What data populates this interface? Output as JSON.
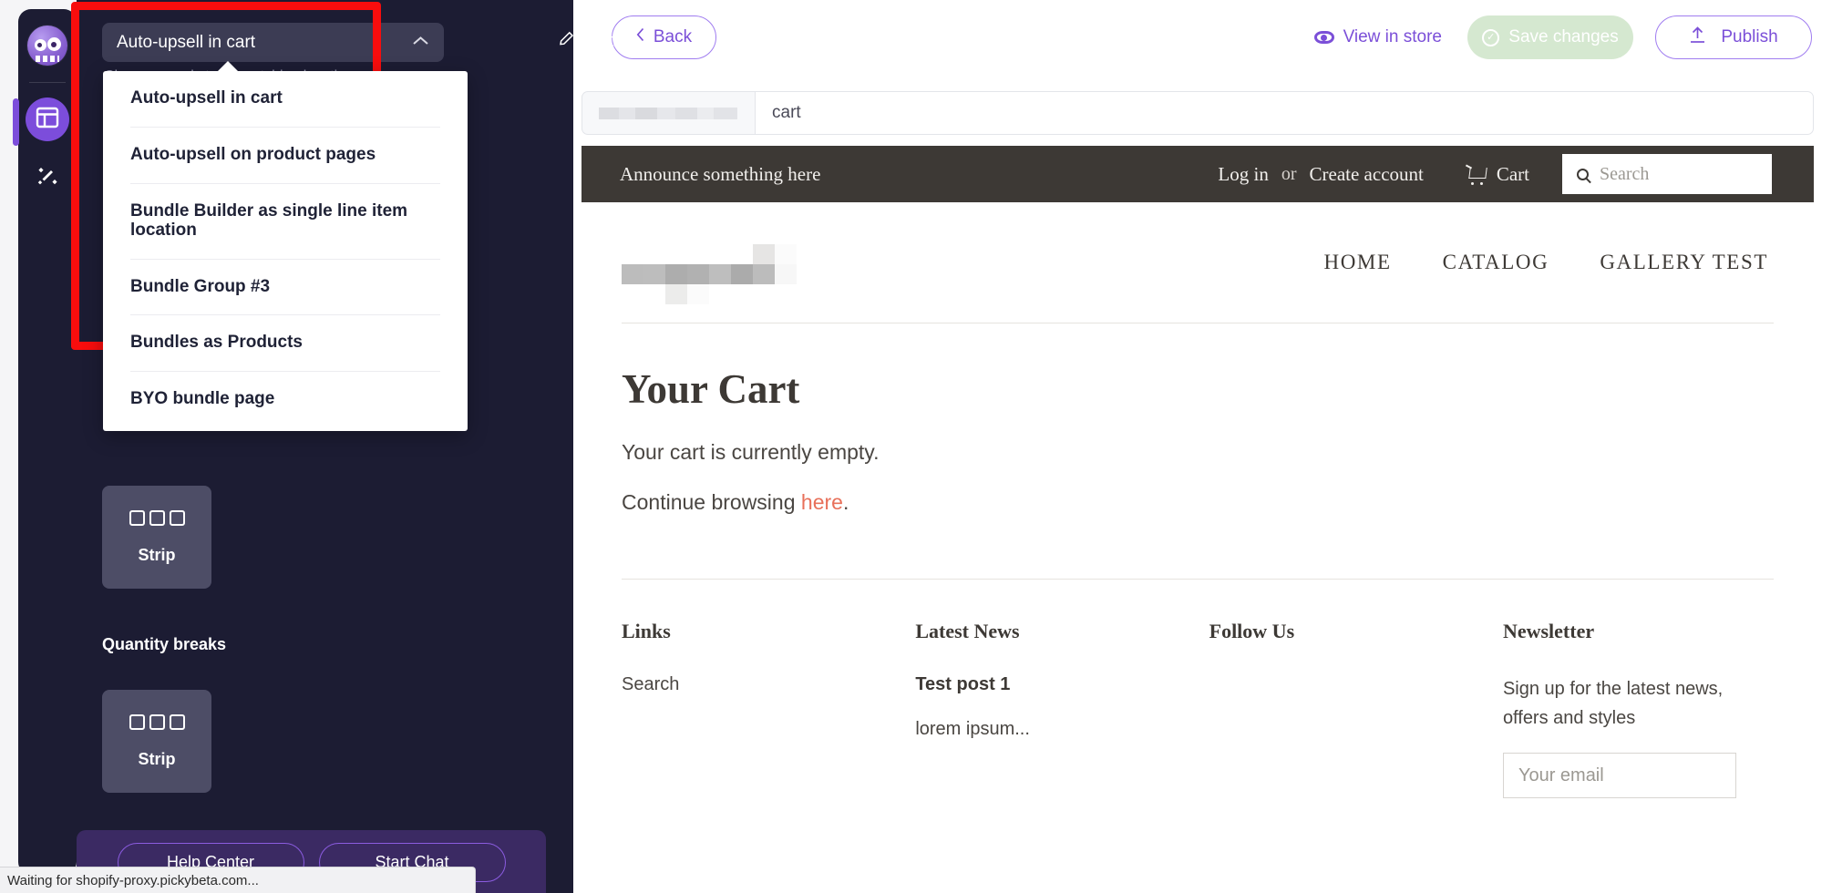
{
  "app": {
    "rail": {
      "logo_name": "app-logo",
      "items": [
        {
          "name": "layout-icon",
          "label": "Layout"
        },
        {
          "name": "sparkle-wand-icon",
          "label": "Magic"
        }
      ]
    },
    "location_select": {
      "value": "Auto-upsell in cart",
      "caret": "chevron-up-icon",
      "hint": "Changes apply to all matching location pages",
      "edit_label": "Edit",
      "options": [
        "Auto-upsell in cart",
        "Auto-upsell on product pages",
        "Bundle Builder as single line item location",
        "Bundle Group #3",
        "Bundles as Products",
        "BYO bundle page"
      ]
    },
    "blocks": [
      {
        "label": "Strip",
        "group": ""
      },
      {
        "label": "Strip",
        "group": "Quantity breaks"
      }
    ],
    "group_label": "Quantity breaks",
    "support": {
      "help_center": "Help Center",
      "start_chat": "Start Chat"
    }
  },
  "toolbar": {
    "back": "Back",
    "view_in_store": "View in store",
    "save_changes": "Save changes",
    "publish": "Publish"
  },
  "urlbar": {
    "domain_redacted": "",
    "path": "cart"
  },
  "store": {
    "announcement": "Announce something here",
    "login": "Log in",
    "or": "or",
    "create_account": "Create account",
    "cart": "Cart",
    "search_placeholder": "Search",
    "nav": [
      "HOME",
      "CATALOG",
      "GALLERY TEST"
    ],
    "page": {
      "title": "Your Cart",
      "empty_message": "Your cart is currently empty.",
      "continue_prefix": "Continue browsing ",
      "continue_link": "here",
      "continue_suffix": "."
    },
    "footer": {
      "links_heading": "Links",
      "links": [
        "Search"
      ],
      "news_heading": "Latest News",
      "news_post_title": "Test post 1",
      "news_excerpt": "lorem ipsum...",
      "follow_heading": "Follow Us",
      "newsletter_heading": "Newsletter",
      "newsletter_text": "Sign up for the latest news, offers and styles",
      "email_placeholder": "Your email"
    }
  },
  "status": {
    "text": "Waiting for shopify-proxy.pickybeta.com..."
  },
  "colors": {
    "panel_bg": "#1c1c33",
    "accent_purple": "#7b4fd8",
    "highlight_red": "#f80d0d",
    "store_dark": "#3d3935",
    "link_coral": "#e8705a",
    "save_disabled": "#d5e8d0"
  }
}
